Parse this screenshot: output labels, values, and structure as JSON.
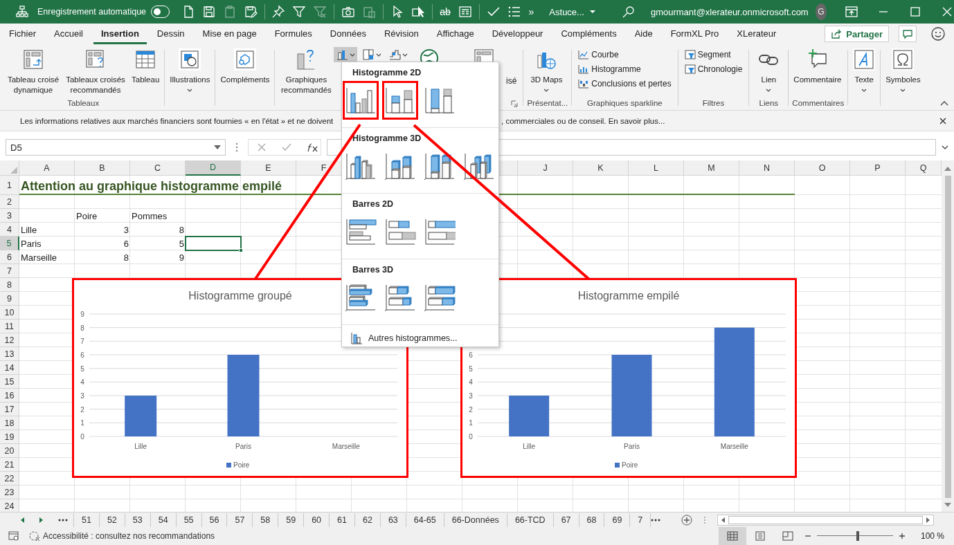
{
  "title_bar": {
    "autosave_label": "Enregistrement automatique",
    "autosave_on": false,
    "quick_access": [
      {
        "disabled": false
      },
      {
        "disabled": false
      },
      {
        "disabled": true
      },
      {
        "disabled": false
      },
      {
        "disabled": false
      },
      {
        "disabled": false
      },
      {
        "disabled": true
      },
      {
        "disabled": false
      },
      {
        "disabled": true
      },
      {
        "disabled": false
      },
      {
        "disabled": false
      },
      {
        "disabled": false,
        "glyph": "ab"
      },
      {
        "disabled": false
      },
      {
        "disabled": false
      },
      {
        "disabled": false
      },
      {
        "disabled": false,
        "glyph": "»"
      }
    ],
    "file_name": "Astuce...",
    "account": "gmourmant@xlerateur.onmicrosoft.com",
    "avatar": "G"
  },
  "ribbon_tabs": [
    {
      "label": "Fichier",
      "selected": false
    },
    {
      "label": "Accueil",
      "selected": false
    },
    {
      "label": "Insertion",
      "selected": true
    },
    {
      "label": "Dessin",
      "selected": false
    },
    {
      "label": "Mise en page",
      "selected": false
    },
    {
      "label": "Formules",
      "selected": false
    },
    {
      "label": "Données",
      "selected": false
    },
    {
      "label": "Révision",
      "selected": false
    },
    {
      "label": "Affichage",
      "selected": false
    },
    {
      "label": "Développeur",
      "selected": false
    },
    {
      "label": "Compléments",
      "selected": false
    },
    {
      "label": "Aide",
      "selected": false
    },
    {
      "label": "FormXL Pro",
      "selected": false
    },
    {
      "label": "XLerateur",
      "selected": false
    }
  ],
  "share_button": "Partager",
  "ribbon": {
    "tableaux": {
      "buttons": [
        "Tableau croisé dynamique",
        "Tableaux croisés recommandés",
        "Tableau"
      ],
      "label": "Tableaux"
    },
    "illustrations": "Illustrations",
    "complements": "Compléments",
    "charts": {
      "recommended": "Graphiques recommandés",
      "gallery_open": true,
      "cut_label": "isé"
    },
    "presentation": {
      "button": "3D Maps",
      "label": "Présentat..."
    },
    "sparkline": {
      "items": [
        "Courbe",
        "Histogramme",
        "Conclusions et pertes"
      ],
      "label": "Graphiques sparkline"
    },
    "filtres": {
      "items": [
        "Segment",
        "Chronologie"
      ],
      "label": "Filtres"
    },
    "liens": {
      "button": "Lien",
      "label": "Liens"
    },
    "commentaires": {
      "button": "Commentaire",
      "label": "Commentaires"
    },
    "texte": "Texte",
    "symboles": "Symboles"
  },
  "info_bar": {
    "text_start": "Les informations relatives aux marchés financiers sont fournies « en l'état » et ne doivent",
    "text_end": ", commerciales ou de conseil. En savoir plus..."
  },
  "formula_bar": {
    "name_box": "D5"
  },
  "sheet": {
    "columns_left": [
      {
        "label": "A",
        "selected": false
      },
      {
        "label": "B",
        "selected": false
      },
      {
        "label": "C",
        "selected": false
      },
      {
        "label": "D",
        "selected": true
      },
      {
        "label": "E",
        "selected": false
      },
      {
        "label": "F",
        "selected": false
      }
    ],
    "columns_right": [
      {
        "label": "J",
        "selected": false
      },
      {
        "label": "K",
        "selected": false
      },
      {
        "label": "L",
        "selected": false
      },
      {
        "label": "M",
        "selected": false
      },
      {
        "label": "N",
        "selected": false
      },
      {
        "label": "O",
        "selected": false
      },
      {
        "label": "P",
        "selected": false
      },
      {
        "label": "Q",
        "selected": false
      }
    ],
    "rows": [
      {
        "label": "1",
        "selected": false,
        "cells": [
          {
            "kind": "title",
            "text": "Attention au graphique histogramme empilé"
          }
        ]
      },
      {
        "label": "2",
        "selected": false
      },
      {
        "label": "3",
        "selected": false,
        "cells": [
          {
            "kind": "empty"
          },
          {
            "kind": "text",
            "text": "Poire"
          },
          {
            "kind": "text",
            "text": "Pommes"
          }
        ]
      },
      {
        "label": "4",
        "selected": false,
        "cells": [
          {
            "kind": "text",
            "text": "Lille"
          },
          {
            "kind": "number",
            "text": "3"
          },
          {
            "kind": "number",
            "text": "8"
          }
        ]
      },
      {
        "label": "5",
        "selected": true,
        "cells": [
          {
            "kind": "text",
            "text": "Paris"
          },
          {
            "kind": "number",
            "text": "6"
          },
          {
            "kind": "number",
            "text": "5"
          }
        ]
      },
      {
        "label": "6",
        "selected": false,
        "cells": [
          {
            "kind": "text",
            "text": "Marseille"
          },
          {
            "kind": "number",
            "text": "8"
          },
          {
            "kind": "number",
            "text": "9"
          }
        ]
      },
      {
        "label": "7",
        "selected": false
      },
      {
        "label": "8",
        "selected": false
      },
      {
        "label": "9",
        "selected": false
      },
      {
        "label": "10",
        "selected": false
      },
      {
        "label": "11",
        "selected": false
      },
      {
        "label": "12",
        "selected": false
      },
      {
        "label": "13",
        "selected": false
      },
      {
        "label": "14",
        "selected": false
      },
      {
        "label": "15",
        "selected": false
      },
      {
        "label": "16",
        "selected": false
      },
      {
        "label": "17",
        "selected": false
      },
      {
        "label": "18",
        "selected": false
      },
      {
        "label": "19",
        "selected": false
      },
      {
        "label": "20",
        "selected": false
      },
      {
        "label": "21",
        "selected": false
      },
      {
        "label": "22",
        "selected": false
      },
      {
        "label": "23",
        "selected": false
      },
      {
        "label": "24",
        "selected": false
      }
    ]
  },
  "charts": [
    {
      "chart_data": {
        "type": "bar",
        "grid": true,
        "title": "Histogramme groupé",
        "categories": [
          "Lille",
          "Paris",
          "Marseille"
        ],
        "series": [
          {
            "name": "Poire",
            "color": "#4472c4",
            "values": [
              3,
              6,
              null
            ]
          }
        ],
        "ylim": [
          0,
          9
        ],
        "yticks": [
          0,
          1,
          2,
          3,
          4,
          5,
          6,
          7,
          8,
          9
        ]
      }
    },
    {
      "chart_data": {
        "type": "bar",
        "grid": true,
        "title": "Histogramme empilé",
        "stacked": true,
        "categories": [
          "Lille",
          "Paris",
          "Marseille"
        ],
        "series": [
          {
            "name": "Poire",
            "color": "#4472c4",
            "values": [
              3,
              6,
              8
            ]
          }
        ],
        "ylim": [
          0,
          9
        ],
        "yticks": [
          0,
          1,
          2,
          3,
          4,
          5,
          6
        ]
      }
    }
  ],
  "chart_gallery": {
    "sections": [
      {
        "title": "Histogramme 2D",
        "items": [
          {
            "kind": "clustered",
            "highlighted": true
          },
          {
            "kind": "stacked",
            "highlighted": true
          },
          {
            "kind": "stacked100",
            "highlighted": false
          }
        ]
      },
      {
        "title": "Histogramme 3D",
        "items": [
          {
            "kind": "clustered-3d",
            "highlighted": false
          },
          {
            "kind": "stacked-3d",
            "highlighted": false
          },
          {
            "kind": "stacked100-3d",
            "highlighted": false
          },
          {
            "kind": "column-3d",
            "highlighted": false
          }
        ]
      },
      {
        "title": "Barres 2D",
        "items": [
          {
            "kind": "bar",
            "highlighted": false
          },
          {
            "kind": "bar-stacked",
            "highlighted": false
          },
          {
            "kind": "bar-stacked100",
            "highlighted": false
          }
        ]
      },
      {
        "title": "Barres 3D",
        "items": [
          {
            "kind": "bar-3d",
            "highlighted": false
          },
          {
            "kind": "bar-stacked-3d",
            "highlighted": false
          },
          {
            "kind": "bar-stacked100-3d",
            "highlighted": false
          }
        ]
      }
    ],
    "footer": "Autres histogrammes..."
  },
  "sheet_tabs": [
    "51",
    "52",
    "53",
    "54",
    "55",
    "56",
    "57",
    "58",
    "59",
    "60",
    "61",
    "62",
    "63",
    "64-65",
    "66-Données",
    "66-TCD",
    "67",
    "68",
    "69",
    "7"
  ],
  "status_bar": {
    "accessibility": "Accessibilité : consultez nos recommandations",
    "views": [
      {
        "selected": true
      },
      {
        "selected": false
      },
      {
        "selected": false
      }
    ],
    "zoom": {
      "level": 0.54,
      "label": "100 %"
    }
  }
}
